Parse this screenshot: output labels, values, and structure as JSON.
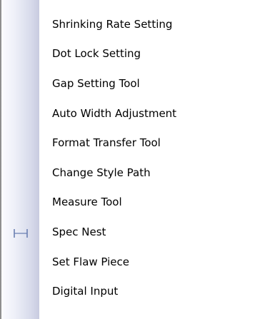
{
  "menu": {
    "items": [
      {
        "label": "Shrinking Rate Setting",
        "icon": ""
      },
      {
        "label": "Dot Lock Setting",
        "icon": ""
      },
      {
        "label": "Gap Setting Tool",
        "icon": ""
      },
      {
        "label": "Auto Width Adjustment",
        "icon": ""
      },
      {
        "label": "Format Transfer Tool",
        "icon": ""
      },
      {
        "label": "Change Style Path",
        "icon": ""
      },
      {
        "label": "Measure Tool",
        "icon": ""
      },
      {
        "label": "Spec Nest",
        "icon": "spec-nest-icon"
      },
      {
        "label": "Set Flaw Piece",
        "icon": ""
      },
      {
        "label": "Digital Input",
        "icon": ""
      }
    ]
  },
  "colors": {
    "gutter_light": "#fbfbff",
    "gutter_dark": "#c8cbe0",
    "icon": "#6a7fb2",
    "text": "#000000"
  }
}
